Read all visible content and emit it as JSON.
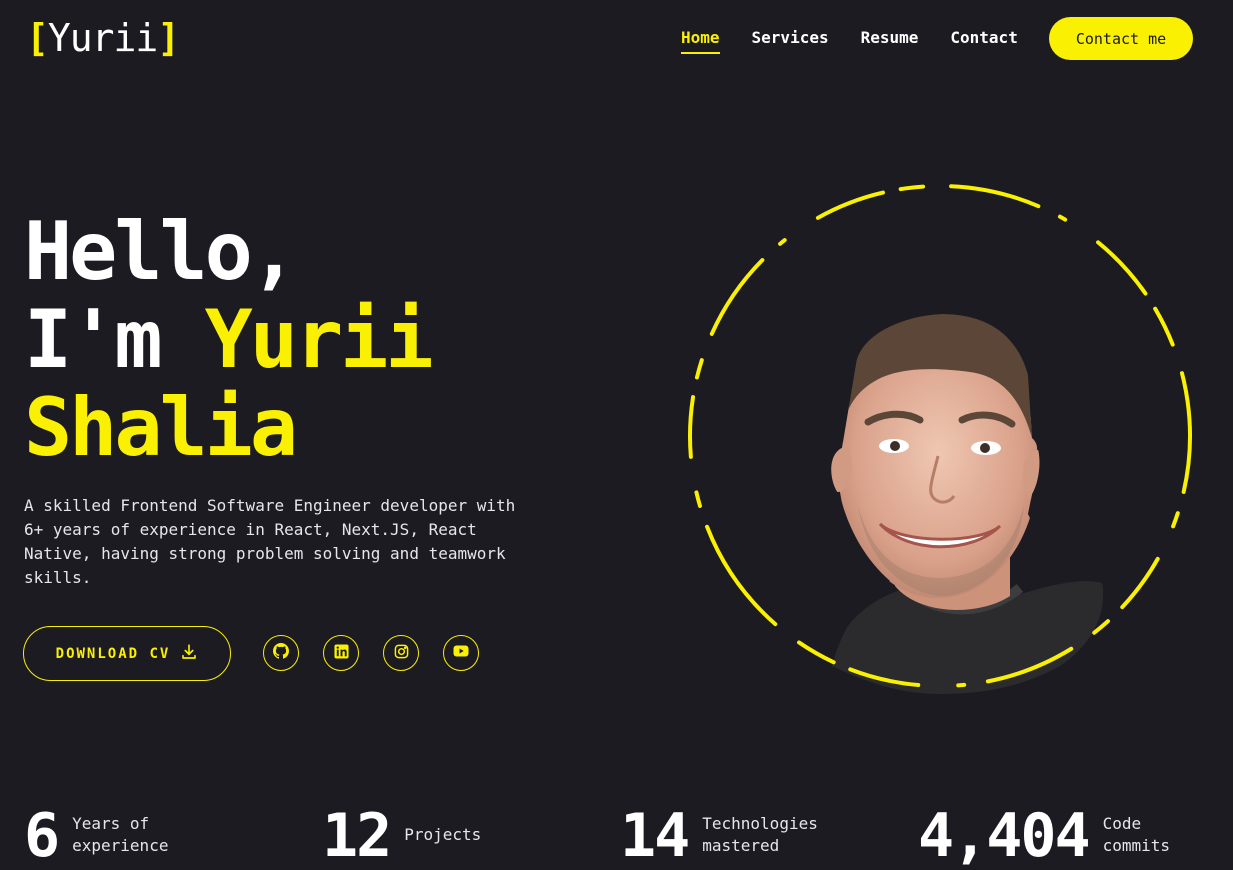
{
  "logo": {
    "open": "[",
    "name": "Yurii",
    "close": "]"
  },
  "nav": [
    {
      "label": "Home",
      "active": true
    },
    {
      "label": "Services"
    },
    {
      "label": "Resume"
    },
    {
      "label": "Contact"
    }
  ],
  "header": {
    "contact_label": "Contact me"
  },
  "hero": {
    "line1": "Hello,",
    "line2_white": "I'm ",
    "line2_yellow": "Yurii",
    "line3": "Shalia",
    "description": "A skilled Frontend Software Engineer developer with 6+ years of experience in React, Next.JS, React Native, having strong problem solving and teamwork skills.",
    "download_label": "DOWNLOAD CV"
  },
  "socials": [
    {
      "icon": "github-icon"
    },
    {
      "icon": "linkedin-icon"
    },
    {
      "icon": "instagram-icon"
    },
    {
      "icon": "youtube-icon"
    }
  ],
  "stats": [
    {
      "number": "6",
      "label_1": "Years of",
      "label_2": "experience"
    },
    {
      "number": "12",
      "label_1": "Projects",
      "label_2": ""
    },
    {
      "number": "14",
      "label_1": "Technologies",
      "label_2": "mastered"
    },
    {
      "number": "4,404",
      "label_1": "Code",
      "label_2": "commits"
    }
  ],
  "colors": {
    "accent": "#f9f002",
    "background": "#1c1b22",
    "text": "#ffffff"
  }
}
